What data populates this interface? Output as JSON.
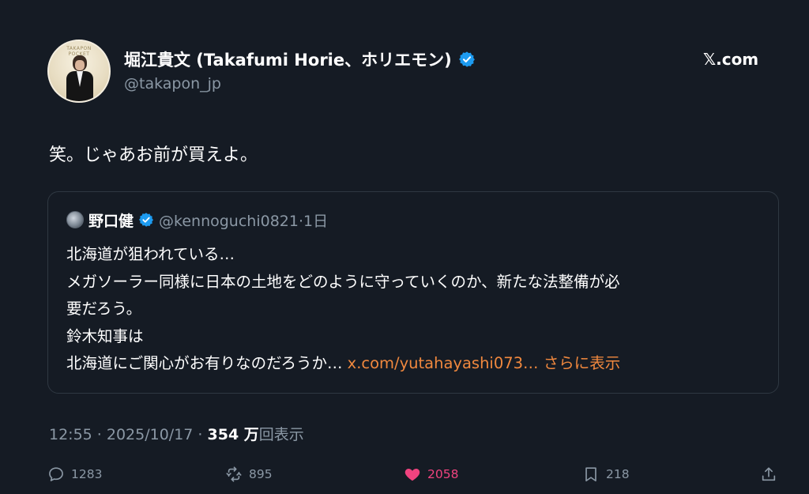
{
  "author": {
    "name": "堀江貴文 (Takafumi Horie、ホリエモン)",
    "handle": "@takapon_jp",
    "avatar_text": "TAKAPON POCKET",
    "verified_color": "#1d9bf0"
  },
  "brand": "𝕏.com",
  "tweet": {
    "text": "笑。じゃあお前が買えよ。"
  },
  "quote": {
    "name": "野口健",
    "handle_time": "@kennoguchi0821·1日",
    "lines": [
      "北海道が狙われている…",
      "メガソーラー同様に日本の土地をどのように守っていくのか、新たな法整備が必",
      "要だろう。",
      "鈴木知事は"
    ],
    "last_line": "北海道にご関心がお有りなのだろうか…",
    "link": "x.com/yutahayashi073…",
    "more": "さらに表示"
  },
  "meta": {
    "time_date": "12:55 · 2025/10/17 · ",
    "views": "354 万",
    "views_label": "回表示"
  },
  "actions": {
    "replies": "1283",
    "reposts": "895",
    "likes": "2058",
    "bookmarks": "218",
    "like_color": "#f0437f"
  }
}
